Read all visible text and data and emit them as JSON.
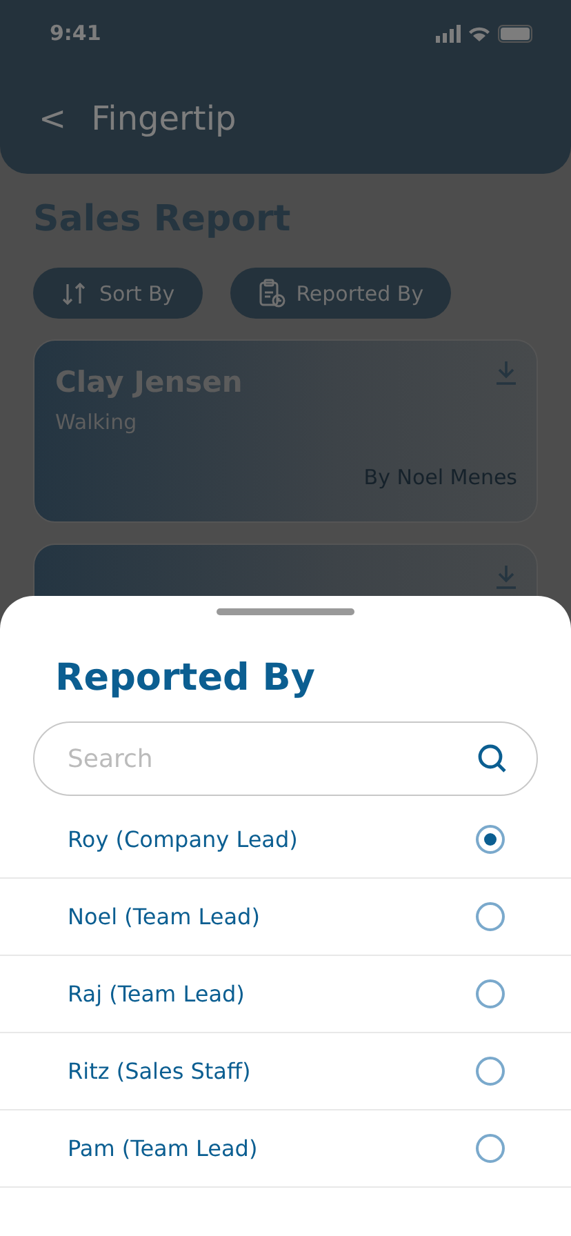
{
  "status_bar": {
    "time": "9:41"
  },
  "header": {
    "back": "<",
    "title": "Fingertip"
  },
  "page_title": "Sales Report",
  "filters": [
    {
      "kind": "sort",
      "label": "Sort By"
    },
    {
      "kind": "reporter",
      "label": "Reported By"
    }
  ],
  "reports": [
    {
      "kind": "full",
      "name": "Clay Jensen",
      "activity": "Walking",
      "by": "By Noel Menes"
    },
    {
      "kind": "covered"
    }
  ],
  "sheet": {
    "title": "Reported By",
    "search": {
      "placeholder": "Search"
    },
    "options": [
      {
        "label": "Roy (Company Lead)",
        "selected": true
      },
      {
        "label": "Noel (Team Lead)",
        "selected": false
      },
      {
        "label": "Raj (Team Lead)",
        "selected": false
      },
      {
        "label": "Ritz (Sales Staff)",
        "selected": false
      },
      {
        "label": "Pam (Team Lead)",
        "selected": false
      }
    ]
  }
}
